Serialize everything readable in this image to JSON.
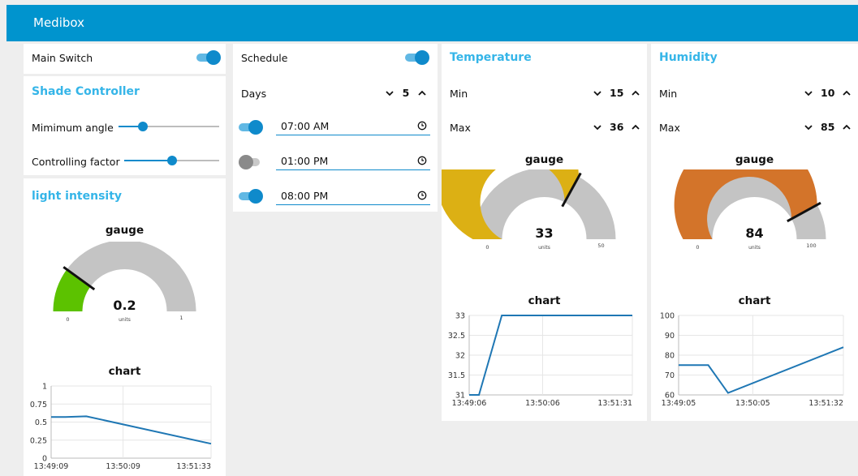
{
  "app": {
    "title": "Medibox"
  },
  "controls": {
    "main_switch_label": "Main Switch",
    "main_switch_on": true,
    "shade_title": "Shade Controller",
    "min_angle_label": "Mimimum angle",
    "min_angle_fraction": 0.24,
    "control_factor_label": "Controlling factor",
    "control_factor_fraction": 0.5,
    "light_title": "light intensity"
  },
  "light_gauge": {
    "title": "gauge",
    "value": 0.2,
    "value_text": "0.2",
    "units": "units",
    "min": 0,
    "max": 1,
    "min_text": "0",
    "max_text": "1",
    "color": "#5cc200"
  },
  "light_chart": {
    "title": "chart",
    "chart_data": {
      "type": "line",
      "title": "chart",
      "x_ticks": [
        "13:49:09",
        "13:50:09",
        "13:51:33"
      ],
      "y_ticks": [
        "1",
        "0.75",
        "0.5",
        "0.25",
        "0"
      ],
      "ylim": [
        0,
        1
      ],
      "series": [
        {
          "values": [
            0.57,
            0.57,
            0.58,
            0.2
          ]
        }
      ],
      "x_positions": [
        0,
        0.09,
        0.22,
        1
      ],
      "color": "#1f77b4",
      "grid": true
    }
  },
  "schedule": {
    "label": "Schedule",
    "enabled": true,
    "days_label": "Days",
    "days_value": "5",
    "times": [
      {
        "value": "07:00 AM",
        "on": true
      },
      {
        "value": "01:00 PM",
        "on": false
      },
      {
        "value": "08:00 PM",
        "on": true
      }
    ]
  },
  "temperature": {
    "title": "Temperature",
    "min_label": "Min",
    "min_value": "15",
    "max_label": "Max",
    "max_value": "36",
    "gauge": {
      "title": "gauge",
      "value": 33,
      "value_text": "33",
      "units": "units",
      "min": 0,
      "max": 50,
      "min_text": "0",
      "max_text": "50",
      "color": "#dcb014"
    },
    "chart": {
      "title": "chart",
      "chart_data": {
        "type": "line",
        "title": "chart",
        "x_ticks": [
          "13:49:06",
          "13:50:06",
          "13:51:31"
        ],
        "y_ticks": [
          "33",
          "32.5",
          "32",
          "31.5",
          "31"
        ],
        "ylim": [
          31,
          33
        ],
        "series": [
          {
            "values": [
              31,
              31,
              33,
              33
            ]
          }
        ],
        "x_positions": [
          0,
          0.06,
          0.2,
          1
        ],
        "color": "#1f77b4",
        "grid": true
      }
    }
  },
  "humidity": {
    "title": "Humidity",
    "min_label": "Min",
    "min_value": "10",
    "max_label": "Max",
    "max_value": "85",
    "gauge": {
      "title": "gauge",
      "value": 84,
      "value_text": "84",
      "units": "units",
      "min": 0,
      "max": 100,
      "min_text": "0",
      "max_text": "100",
      "color": "#d3742a"
    },
    "chart": {
      "title": "chart",
      "chart_data": {
        "type": "line",
        "title": "chart",
        "x_ticks": [
          "13:49:05",
          "13:50:05",
          "13:51:32"
        ],
        "y_ticks": [
          "100",
          "90",
          "80",
          "70",
          "60"
        ],
        "ylim": [
          60,
          100
        ],
        "series": [
          {
            "values": [
              75,
              75,
              61,
              84
            ]
          }
        ],
        "x_positions": [
          0,
          0.18,
          0.3,
          1
        ],
        "color": "#1f77b4",
        "grid": true
      }
    }
  }
}
